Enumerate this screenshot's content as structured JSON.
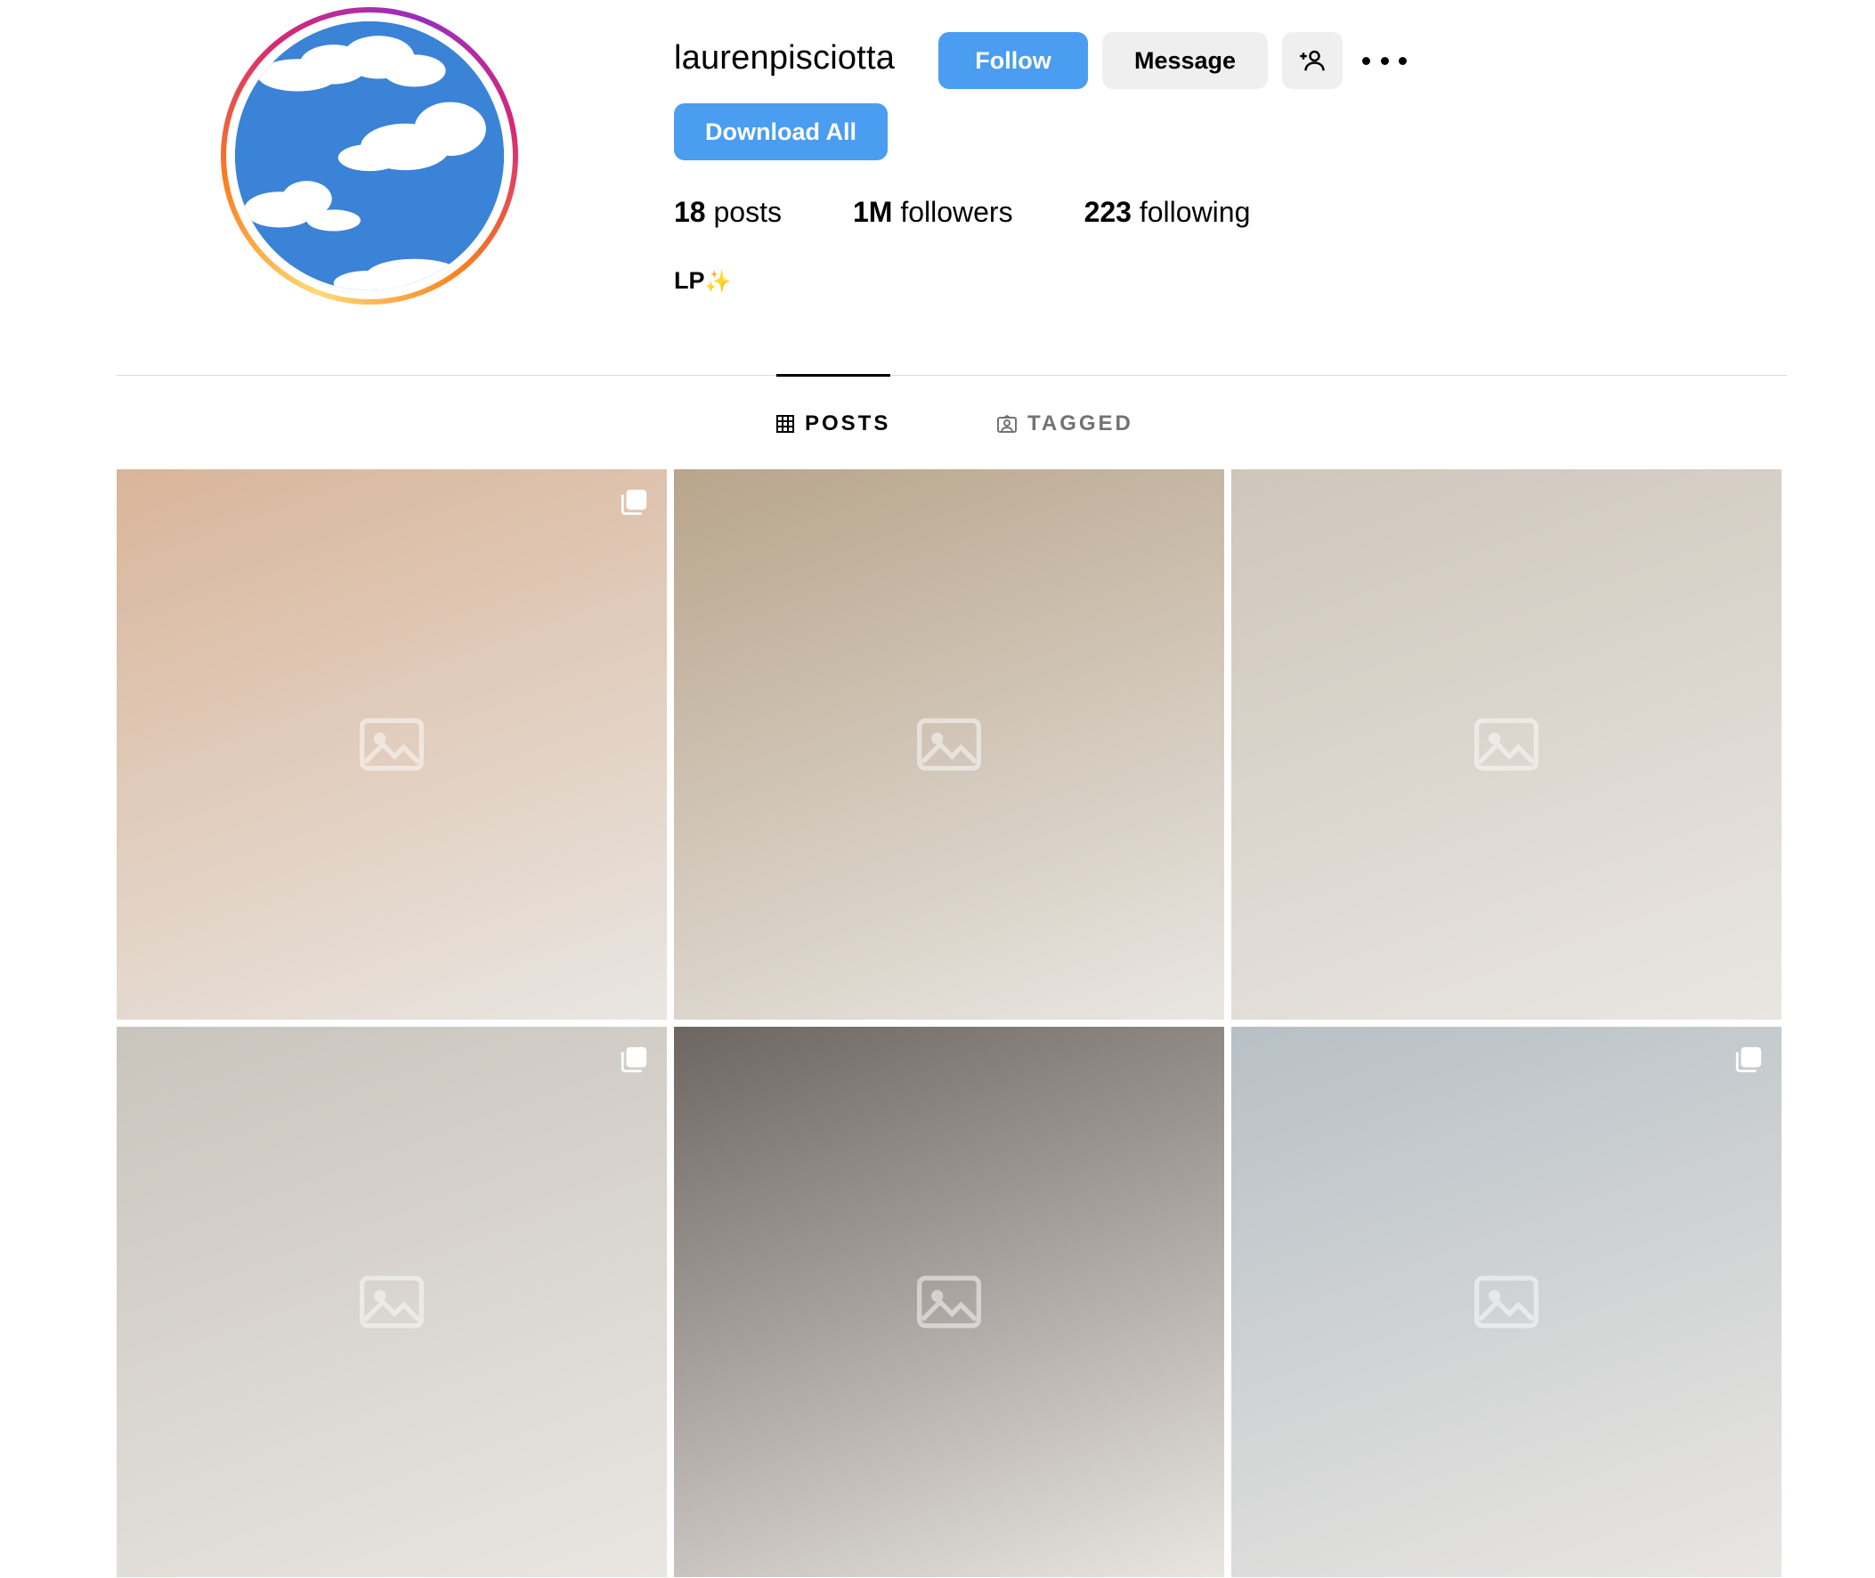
{
  "profile": {
    "username": "laurenpisciotta",
    "bio": "LP",
    "bio_emoji": "✨",
    "avatar_icon": "sky-clouds-avatar"
  },
  "actions": {
    "follow_label": "Follow",
    "message_label": "Message",
    "add_user_icon": "add-person-icon",
    "more_icon": "more-options-icon",
    "download_label": "Download All"
  },
  "stats": [
    {
      "count": "18",
      "label": "posts"
    },
    {
      "count": "1M",
      "label": "followers"
    },
    {
      "count": "223",
      "label": "following"
    }
  ],
  "tabs": [
    {
      "label": "POSTS",
      "icon": "grid-icon",
      "active": true
    },
    {
      "label": "TAGGED",
      "icon": "tagged-person-icon",
      "active": false
    }
  ],
  "posts": [
    {
      "multi": true,
      "tone": "#d9b59a"
    },
    {
      "multi": false,
      "tone": "#b8a58c"
    },
    {
      "multi": false,
      "tone": "#cfc6bb"
    },
    {
      "multi": true,
      "tone": "#c9c4bc"
    },
    {
      "multi": false,
      "tone": "#6d6560"
    },
    {
      "multi": true,
      "tone": "#b7c0c6"
    }
  ],
  "colors": {
    "primary_button": "#4a9df0",
    "secondary_button": "#efefef",
    "divider": "#dbdbdb",
    "inactive_tab": "#737373"
  }
}
